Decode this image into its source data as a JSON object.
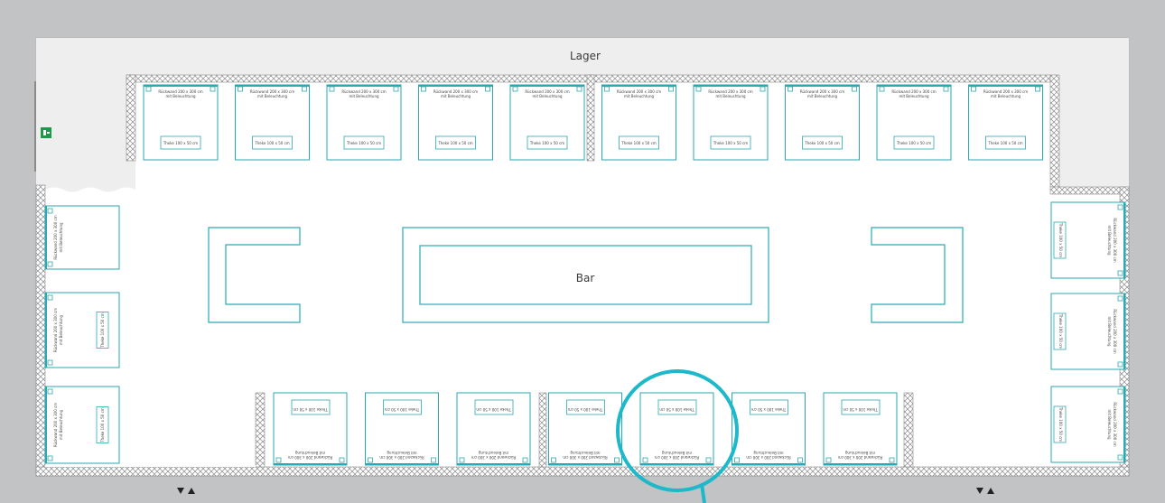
{
  "labels": {
    "lager": "Lager",
    "bar": "Bar"
  },
  "booth": {
    "wall_line1": "Rückwand 200 x 300 cm",
    "wall_line2": "mit Beleuchtung",
    "counter": "Theke 100 x 50 cm",
    "counter_alt": "Theke 100 x 50 cm"
  },
  "icons": {
    "exit": "emergency-exit-sign",
    "doors": "door-arrows"
  },
  "colors": {
    "background": "#c2c3c5",
    "hall": "#ffffff",
    "storage": "#eeeeee",
    "booth_line": "#2aa9b3",
    "wall_hatch": "#8a8a8a",
    "highlight": "#1db8c9"
  }
}
